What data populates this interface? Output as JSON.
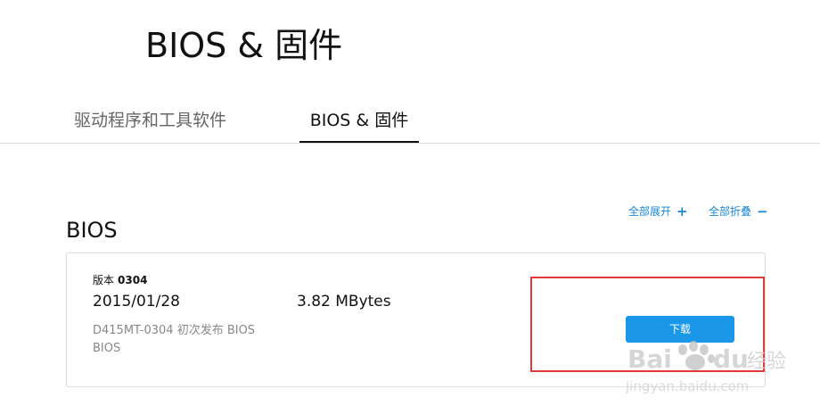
{
  "page": {
    "title": "BIOS & 固件"
  },
  "tabs": [
    {
      "label": "驱动程序和工具软件",
      "active": false
    },
    {
      "label": "BIOS & 固件",
      "active": true
    }
  ],
  "toolbar": {
    "expand_all_label": "全部展开",
    "expand_all_icon": "plus-icon",
    "collapse_all_label": "全部折叠",
    "collapse_all_icon": "minus-icon"
  },
  "section": {
    "title": "BIOS"
  },
  "bios_entry": {
    "version_label": "版本",
    "version_number": "0304",
    "release_date": "2015/01/28",
    "file_size": "3.82 MBytes",
    "description_line1": "D415MT-0304 初次发布 BIOS",
    "description_line2": "BIOS",
    "download_label": "下载"
  },
  "watermark": {
    "brand": "Baidu经验",
    "url": "jingyan.baidu.com"
  },
  "colors": {
    "accent_blue": "#1a97e8",
    "link_blue": "#1a87d4",
    "highlight_red": "#e03a3a"
  }
}
